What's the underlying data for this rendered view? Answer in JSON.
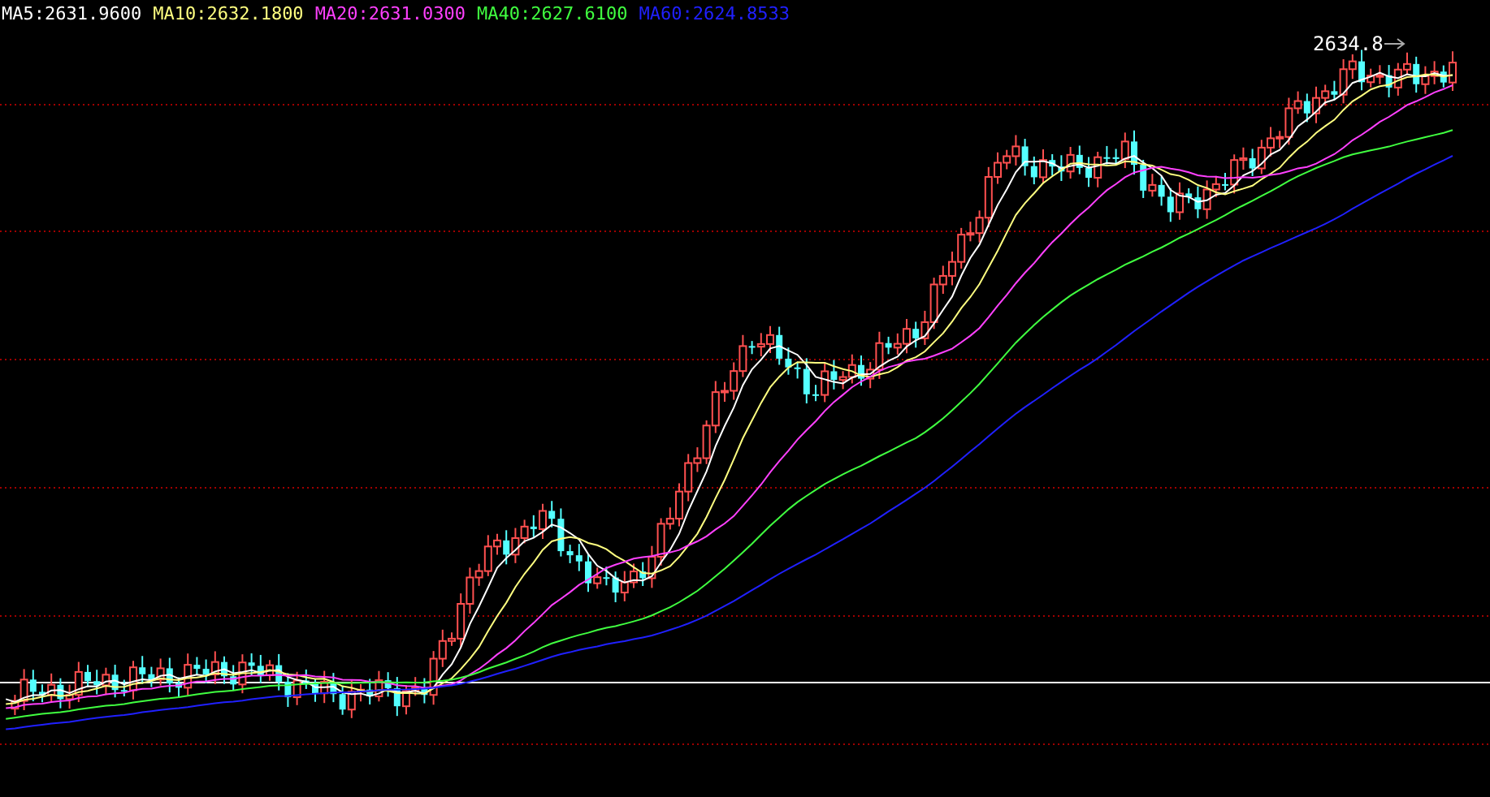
{
  "legend": [
    {
      "label": "MA5:2631.9600",
      "color": "#ffffff"
    },
    {
      "label": "MA10:2632.1800",
      "color": "#ffff80"
    },
    {
      "label": "MA20:2631.0300",
      "color": "#ff40ff"
    },
    {
      "label": "MA40:2627.6100",
      "color": "#40ff40"
    },
    {
      "label": "MA60:2624.8533",
      "color": "#2020ff"
    }
  ],
  "high_marker": {
    "label": "2634.8"
  }
}
